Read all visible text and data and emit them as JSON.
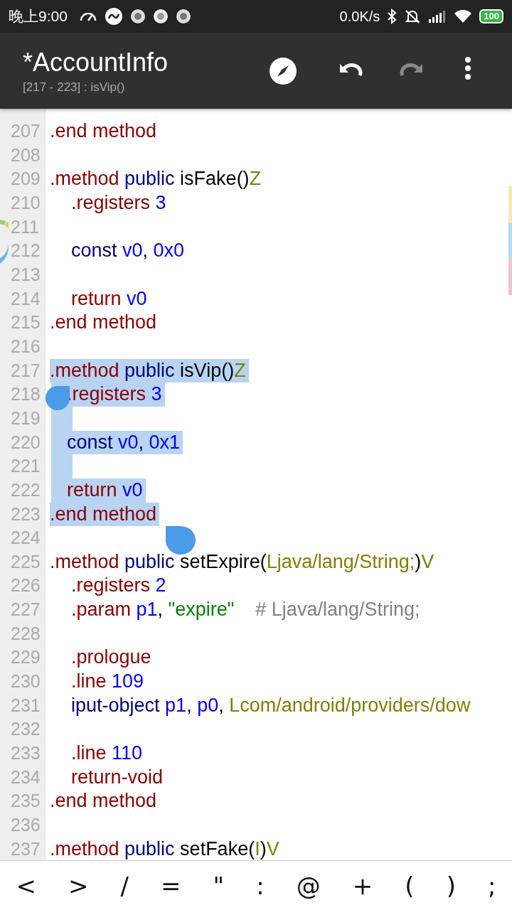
{
  "status_bar": {
    "time": "晚上9:00",
    "net_speed": "0.0K/s",
    "battery": "100"
  },
  "toolbar": {
    "title": "*AccountInfo",
    "subtitle": "[217 - 223] : isVip()",
    "actions": [
      {
        "kind": "navigate",
        "disabled": false
      },
      {
        "kind": "undo",
        "disabled": false
      },
      {
        "kind": "redo",
        "disabled": true
      },
      {
        "kind": "more",
        "disabled": false
      }
    ]
  },
  "editor": {
    "lines": [
      {
        "number": "207",
        "indented": false,
        "selected": false,
        "tokens": [
          {
            "text": ".end method",
            "kind": "directive"
          }
        ]
      },
      {
        "number": "208",
        "selected": false
      },
      {
        "number": "209",
        "indented": false,
        "selected": false,
        "tokens": [
          {
            "text": ".method ",
            "kind": "directive"
          },
          {
            "text": "public ",
            "kind": "keyword"
          },
          {
            "text": "isFake()",
            "kind": "name"
          },
          {
            "text": "Z",
            "kind": "type"
          }
        ]
      },
      {
        "number": "210",
        "indented": true,
        "selected": false,
        "tokens": [
          {
            "text": ".registers ",
            "kind": "directive"
          },
          {
            "text": "3",
            "kind": "number"
          }
        ]
      },
      {
        "number": "211",
        "selected": false
      },
      {
        "number": "212",
        "indented": true,
        "selected": false,
        "tokens": [
          {
            "text": "const ",
            "kind": "opcode"
          },
          {
            "text": "v0",
            "kind": "number"
          },
          {
            "text": ", ",
            "kind": "punctuation"
          },
          {
            "text": "0x0",
            "kind": "number"
          }
        ]
      },
      {
        "number": "213",
        "selected": false
      },
      {
        "number": "214",
        "indented": true,
        "selected": false,
        "tokens": [
          {
            "text": "return ",
            "kind": "directive"
          },
          {
            "text": "v0",
            "kind": "number"
          }
        ]
      },
      {
        "number": "215",
        "indented": false,
        "selected": false,
        "tokens": [
          {
            "text": ".end method",
            "kind": "directive"
          }
        ]
      },
      {
        "number": "216",
        "selected": false
      },
      {
        "number": "217",
        "indented": false,
        "selected": true,
        "tokens": [
          {
            "text": ".method ",
            "kind": "directive"
          },
          {
            "text": "public ",
            "kind": "keyword"
          },
          {
            "text": "isVip()",
            "kind": "name"
          },
          {
            "text": "Z",
            "kind": "type"
          }
        ]
      },
      {
        "number": "218",
        "indented": true,
        "selected": true,
        "tokens": [
          {
            "text": ".registers ",
            "kind": "directive"
          },
          {
            "text": "3",
            "kind": "number"
          }
        ]
      },
      {
        "number": "219",
        "indented": true,
        "selected": true
      },
      {
        "number": "220",
        "indented": true,
        "selected": true,
        "tokens": [
          {
            "text": "const ",
            "kind": "opcode"
          },
          {
            "text": "v0",
            "kind": "number"
          },
          {
            "text": ", ",
            "kind": "punctuation"
          },
          {
            "text": "0x1",
            "kind": "number"
          }
        ]
      },
      {
        "number": "221",
        "indented": true,
        "selected": true
      },
      {
        "number": "222",
        "indented": true,
        "selected": true,
        "tokens": [
          {
            "text": "return ",
            "kind": "directive"
          },
          {
            "text": "v0",
            "kind": "number"
          }
        ]
      },
      {
        "number": "223",
        "indented": false,
        "selected": true,
        "tokens": [
          {
            "text": ".end method",
            "kind": "directive"
          }
        ]
      },
      {
        "number": "224",
        "selected": false
      },
      {
        "number": "225",
        "indented": false,
        "selected": false,
        "tokens": [
          {
            "text": ".method ",
            "kind": "directive"
          },
          {
            "text": "public ",
            "kind": "keyword"
          },
          {
            "text": "setExpire(",
            "kind": "name"
          },
          {
            "text": "Ljava/lang/String;",
            "kind": "type"
          },
          {
            "text": ")",
            "kind": "name"
          },
          {
            "text": "V",
            "kind": "type"
          }
        ]
      },
      {
        "number": "226",
        "indented": true,
        "selected": false,
        "tokens": [
          {
            "text": ".registers ",
            "kind": "directive"
          },
          {
            "text": "2",
            "kind": "number"
          }
        ]
      },
      {
        "number": "227",
        "indented": true,
        "selected": false,
        "tokens": [
          {
            "text": ".param ",
            "kind": "directive"
          },
          {
            "text": "p1",
            "kind": "number"
          },
          {
            "text": ", ",
            "kind": "punctuation"
          },
          {
            "text": "\"expire\"",
            "kind": "string"
          },
          {
            "text": "    # Ljava/lang/String;",
            "kind": "comment"
          }
        ]
      },
      {
        "number": "228",
        "selected": false
      },
      {
        "number": "229",
        "indented": true,
        "selected": false,
        "tokens": [
          {
            "text": ".prologue",
            "kind": "directive"
          }
        ]
      },
      {
        "number": "230",
        "indented": true,
        "selected": false,
        "tokens": [
          {
            "text": ".line ",
            "kind": "directive"
          },
          {
            "text": "109",
            "kind": "number"
          }
        ]
      },
      {
        "number": "231",
        "indented": true,
        "selected": false,
        "tokens": [
          {
            "text": "iput-object ",
            "kind": "opcode"
          },
          {
            "text": "p1",
            "kind": "number"
          },
          {
            "text": ", ",
            "kind": "punctuation"
          },
          {
            "text": "p0",
            "kind": "number"
          },
          {
            "text": ", ",
            "kind": "punctuation"
          },
          {
            "text": "Lcom/android/providers/dow",
            "kind": "type"
          }
        ]
      },
      {
        "number": "232",
        "selected": false
      },
      {
        "number": "233",
        "indented": true,
        "selected": false,
        "tokens": [
          {
            "text": ".line ",
            "kind": "directive"
          },
          {
            "text": "110",
            "kind": "number"
          }
        ]
      },
      {
        "number": "234",
        "indented": true,
        "selected": false,
        "tokens": [
          {
            "text": "return-void",
            "kind": "directive"
          }
        ]
      },
      {
        "number": "235",
        "indented": false,
        "selected": false,
        "tokens": [
          {
            "text": ".end method",
            "kind": "directive"
          }
        ]
      },
      {
        "number": "236",
        "selected": false
      },
      {
        "number": "237",
        "indented": false,
        "selected": false,
        "tokens": [
          {
            "text": ".method ",
            "kind": "directive"
          },
          {
            "text": "public ",
            "kind": "keyword"
          },
          {
            "text": "setFake(",
            "kind": "name"
          },
          {
            "text": "I",
            "kind": "type"
          },
          {
            "text": ")",
            "kind": "name"
          },
          {
            "text": "V",
            "kind": "type"
          }
        ]
      }
    ],
    "markers": [
      {
        "color": "#fbe6b4"
      },
      {
        "color": "#b5dcf2"
      },
      {
        "color": "#f2c2d2"
      }
    ]
  },
  "symbol_keys": [
    "<",
    ">",
    "/",
    "=",
    "\"",
    ":",
    "@",
    "+",
    "(",
    ")",
    ";"
  ]
}
